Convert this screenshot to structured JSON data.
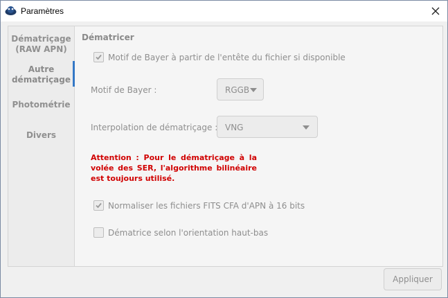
{
  "window": {
    "title": "Paramètres"
  },
  "sidebar": {
    "items": [
      {
        "label_line1": "Dématriçage",
        "label_line2": "(RAW APN)"
      },
      {
        "label_line1": "Autre",
        "label_line2": "dématriçage"
      },
      {
        "label_line1": "Photométrie"
      },
      {
        "label_line1": "Divers"
      }
    ],
    "active_index": 1
  },
  "panel": {
    "section_title": "Dématricer",
    "bayer_from_header": {
      "label": "Motif de Bayer à partir de l'entête du fichier si disponible",
      "checked": true
    },
    "bayer_pattern": {
      "label": "Motif de Bayer :",
      "value": "RGGB"
    },
    "interpolation": {
      "label": "Interpolation de dématriçage :",
      "value": "VNG"
    },
    "warning": "Attention : Pour le dématriçage à la volée des SER, l'algorithme bilinéaire est toujours utilisé.",
    "normalize_fits": {
      "label": "Normaliser les fichiers FITS CFA d'APN à 16 bits",
      "checked": true
    },
    "top_bottom": {
      "label": "Dématrice selon l'orientation haut-bas",
      "checked": false
    }
  },
  "footer": {
    "apply_label": "Appliquer"
  },
  "colors": {
    "accent": "#3478c6",
    "warning": "#d00000"
  }
}
